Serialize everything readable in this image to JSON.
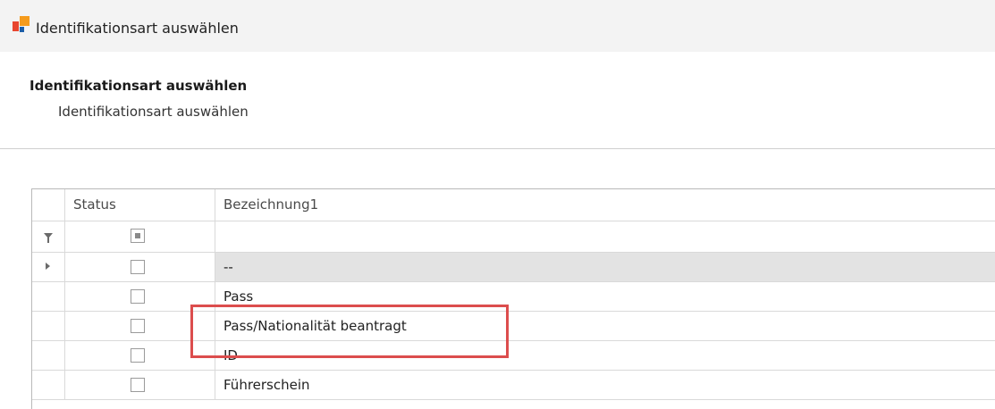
{
  "window": {
    "title": "Identifikationsart auswählen"
  },
  "page": {
    "heading": "Identifikationsart auswählen",
    "subheading": "Identifikationsart auswählen"
  },
  "grid": {
    "columns": {
      "status": "Status",
      "name": "Bezeichnung1"
    },
    "rows": [
      {
        "name": "--",
        "checked": false,
        "selected": true
      },
      {
        "name": "Pass",
        "checked": false,
        "selected": false
      },
      {
        "name": "Pass/Nationalität beantragt",
        "checked": false,
        "selected": false
      },
      {
        "name": "ID",
        "checked": false,
        "selected": false
      },
      {
        "name": "Führerschein",
        "checked": false,
        "selected": false
      }
    ]
  },
  "annotation": {
    "color": "#dc4d4d",
    "target": "Pass/Nationalität beantragt"
  },
  "icons": {
    "app": "app-logo-icon",
    "filter": "filter-icon",
    "row_indicator": "row-pointer-icon"
  }
}
